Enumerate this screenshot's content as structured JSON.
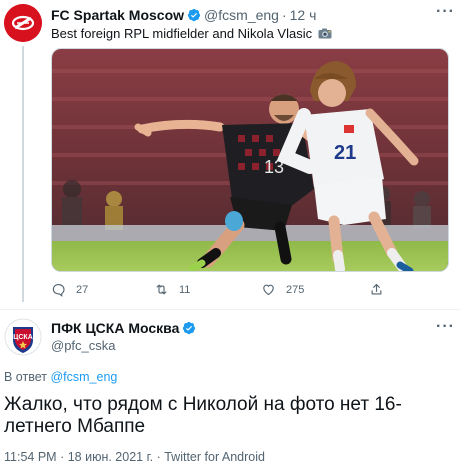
{
  "original_tweet": {
    "author_name": "FC Spartak Moscow",
    "author_handle": "@fcsm_eng",
    "separator": "·",
    "time_ago": "12 ч",
    "text": "Best foreign RPL midfielder and Nikola Vlasic",
    "text_emoji": "camera-icon",
    "photo": "football-match-photo",
    "actions": {
      "reply_count": "27",
      "retweet_count": "11",
      "like_count": "275"
    }
  },
  "reply_tweet": {
    "author_name": "ПФК ЦСКА Москва",
    "author_handle": "@pfc_cska",
    "replying_prefix": "В ответ",
    "replying_to": "@fcsm_eng",
    "text": "Жалко, что рядом с Николой на фото нет 16-летнего Мбаппе",
    "time": "11:54 PM",
    "dot1": "·",
    "date": "18 июн. 2021 г.",
    "dot2": "·",
    "source": "Twitter for Android"
  },
  "colors": {
    "accent": "#1d9bf0",
    "spartak_red": "#d8111f",
    "cska_red": "#c8102e",
    "cska_blue": "#1b3a8c",
    "muted": "#536471"
  }
}
